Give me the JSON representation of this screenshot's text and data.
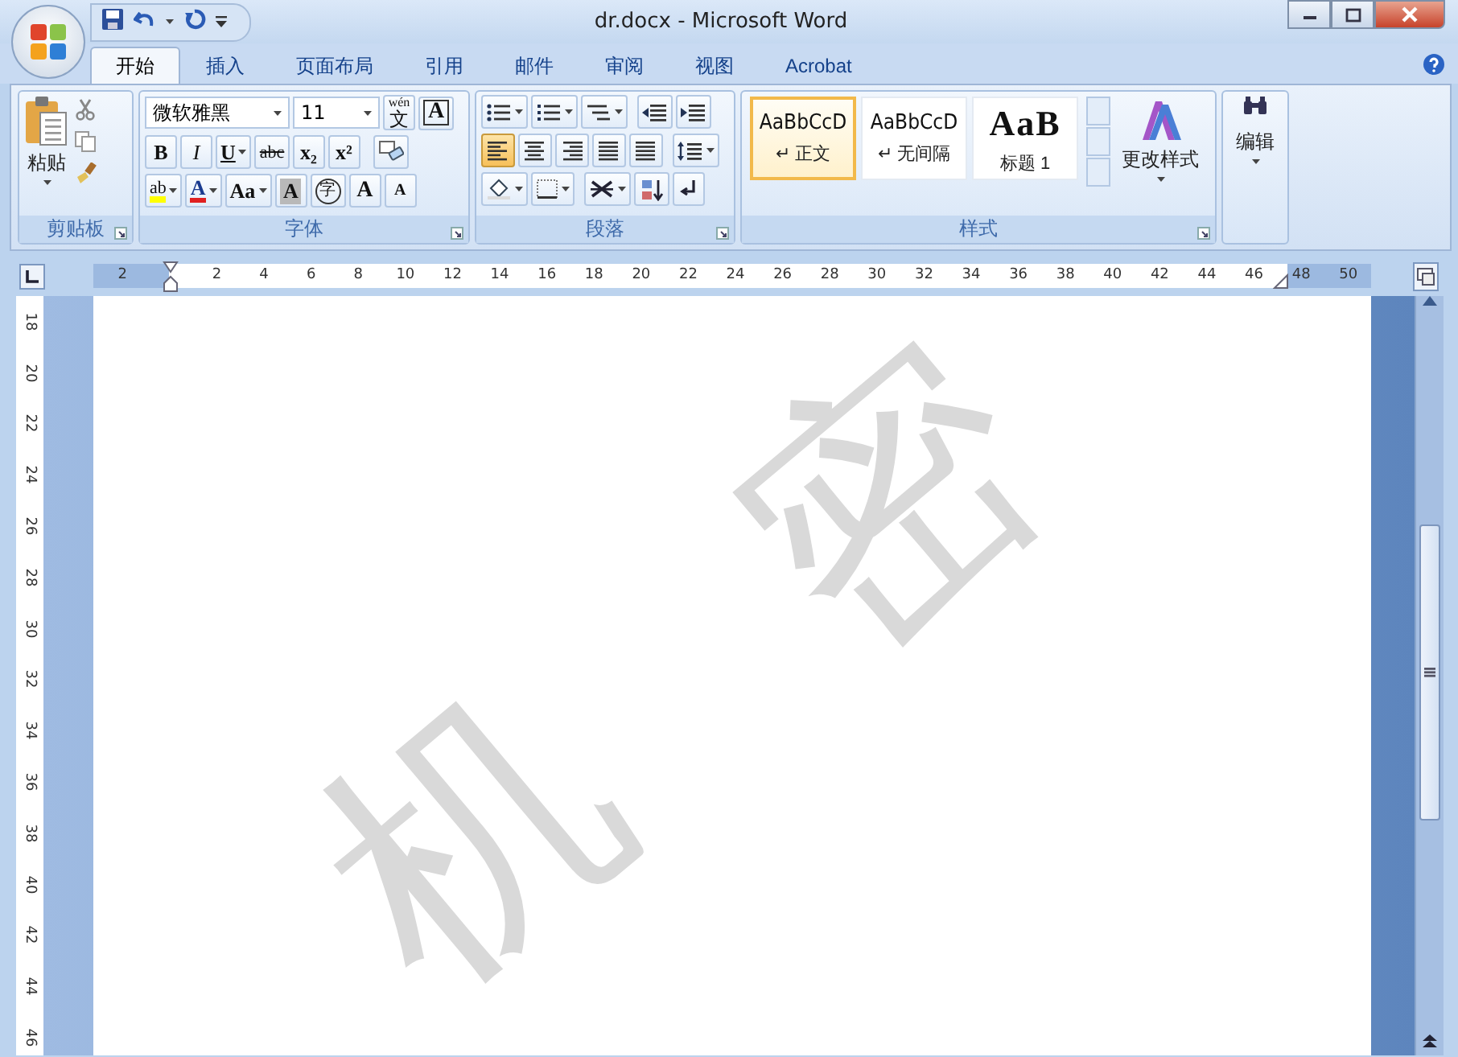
{
  "window": {
    "title": "dr.docx - Microsoft Word"
  },
  "tabs": [
    {
      "label": "开始",
      "selected": true
    },
    {
      "label": "插入",
      "selected": false
    },
    {
      "label": "页面布局",
      "selected": false
    },
    {
      "label": "引用",
      "selected": false
    },
    {
      "label": "邮件",
      "selected": false
    },
    {
      "label": "审阅",
      "selected": false
    },
    {
      "label": "视图",
      "selected": false
    },
    {
      "label": "Acrobat",
      "selected": false
    }
  ],
  "clipboard": {
    "title": "剪贴板",
    "paste_label": "粘贴"
  },
  "font": {
    "title": "字体",
    "font_name": "微软雅黑",
    "font_size": "11",
    "phonetic_label": "wén",
    "phonetic_char": "文",
    "boxed_label": "A",
    "row2": [
      {
        "label": "B",
        "kind": "bold",
        "dropdown": false
      },
      {
        "label": "I",
        "kind": "italic",
        "dropdown": false
      },
      {
        "label": "U",
        "kind": "underline",
        "dropdown": true
      },
      {
        "label": "abc",
        "kind": "strike",
        "dropdown": false
      },
      {
        "label": "x₂",
        "kind": "plain",
        "dropdown": false
      },
      {
        "label": "x²",
        "kind": "plain",
        "dropdown": false
      }
    ],
    "row3": [
      {
        "label": "ab",
        "kind": "highlight",
        "dropdown": true
      },
      {
        "label": "A",
        "kind": "color",
        "dropdown": true
      },
      {
        "label": "Aa",
        "kind": "plain",
        "dropdown": true
      },
      {
        "label": "A",
        "kind": "shaded",
        "dropdown": false
      },
      {
        "label": "字",
        "kind": "circled",
        "dropdown": false
      },
      {
        "label": "A",
        "kind": "grow",
        "dropdown": false
      },
      {
        "label": "A",
        "kind": "shrink",
        "dropdown": false
      }
    ]
  },
  "paragraph": {
    "title": "段落",
    "alignments": [
      {
        "selected": true
      },
      {
        "selected": false
      },
      {
        "selected": false
      },
      {
        "selected": false
      },
      {
        "selected": false
      }
    ]
  },
  "styles": {
    "title": "样式",
    "change_label": "更改样式",
    "gallery": [
      {
        "preview": "AaBbCcD",
        "name": "↵ 正文",
        "kind": "normal",
        "selected": true
      },
      {
        "preview": "AaBbCcD",
        "name": "↵ 无间隔",
        "kind": "normal",
        "selected": false
      },
      {
        "preview": "AaB",
        "name": "标题 1",
        "kind": "heading",
        "selected": false
      }
    ]
  },
  "editing": {
    "label": "编辑"
  },
  "ruler": {
    "labels": [
      "2",
      "2",
      "4",
      "6",
      "8",
      "10",
      "12",
      "14",
      "16",
      "18",
      "20",
      "22",
      "24",
      "26",
      "28",
      "30",
      "32",
      "34",
      "36",
      "38",
      "40",
      "42",
      "44",
      "46",
      "48",
      "50"
    ]
  },
  "vertical_ruler": {
    "labels": [
      "18",
      "20",
      "22",
      "24",
      "26",
      "28",
      "30",
      "32",
      "34",
      "36",
      "38",
      "40",
      "42",
      "44",
      "46"
    ]
  },
  "document": {
    "watermark": [
      "机",
      "密"
    ]
  }
}
